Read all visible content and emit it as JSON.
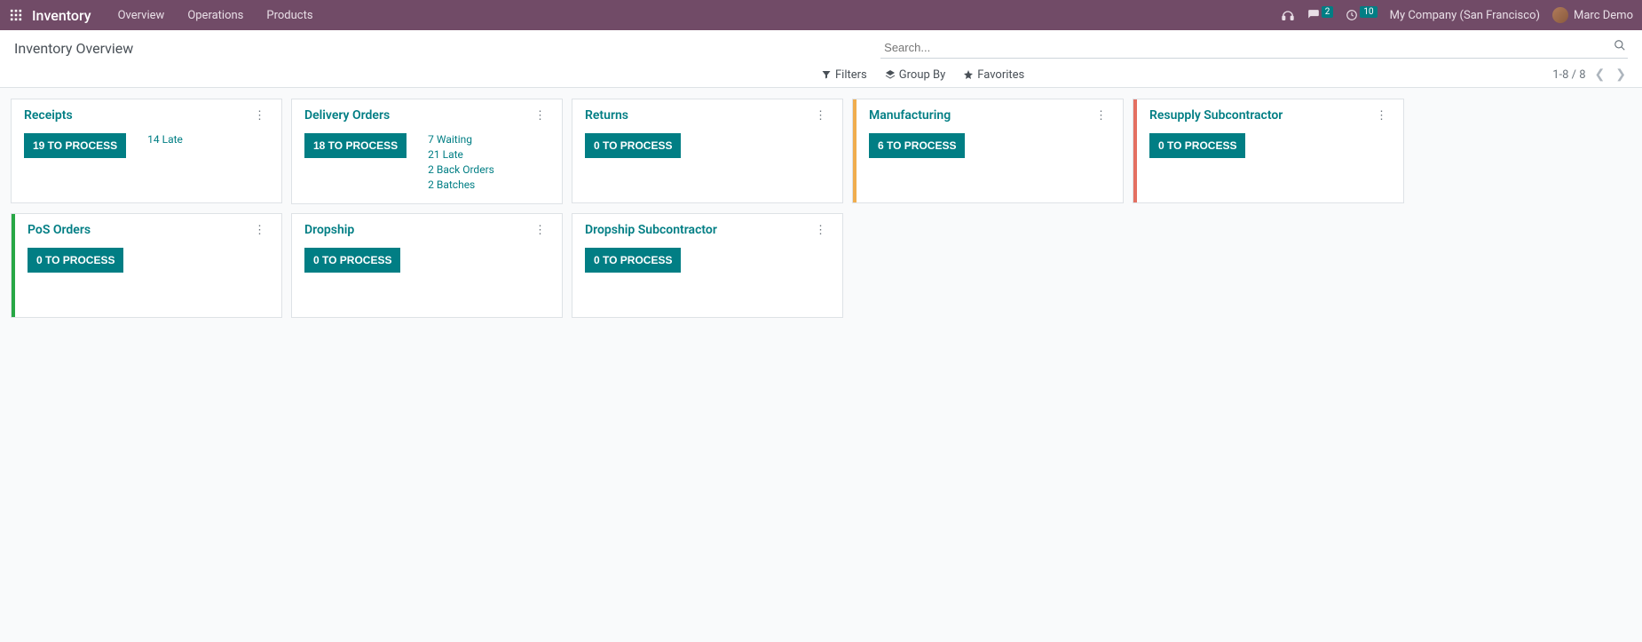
{
  "topnav": {
    "brand": "Inventory",
    "links": [
      "Overview",
      "Operations",
      "Products"
    ],
    "messages_badge": "2",
    "activities_badge": "10",
    "company": "My Company (San Francisco)",
    "user": "Marc Demo"
  },
  "control_panel": {
    "title": "Inventory Overview",
    "search_placeholder": "Search...",
    "filters_label": "Filters",
    "groupby_label": "Group By",
    "favorites_label": "Favorites",
    "pager": "1-8 / 8"
  },
  "cards": [
    {
      "title": "Receipts",
      "button": "19 TO PROCESS",
      "extras": [
        "14 Late"
      ],
      "bar": null
    },
    {
      "title": "Delivery Orders",
      "button": "18 TO PROCESS",
      "extras": [
        "7 Waiting",
        "21 Late",
        "2 Back Orders",
        "2 Batches"
      ],
      "bar": null
    },
    {
      "title": "Returns",
      "button": "0 TO PROCESS",
      "extras": [],
      "bar": null
    },
    {
      "title": "Manufacturing",
      "button": "6 TO PROCESS",
      "extras": [],
      "bar": "#f0ad4e"
    },
    {
      "title": "Resupply Subcontractor",
      "button": "0 TO PROCESS",
      "extras": [],
      "bar": "#e46f61"
    },
    {
      "title": "PoS Orders",
      "button": "0 TO PROCESS",
      "extras": [],
      "bar": "#28a745"
    },
    {
      "title": "Dropship",
      "button": "0 TO PROCESS",
      "extras": [],
      "bar": null
    },
    {
      "title": "Dropship Subcontractor",
      "button": "0 TO PROCESS",
      "extras": [],
      "bar": null
    }
  ]
}
